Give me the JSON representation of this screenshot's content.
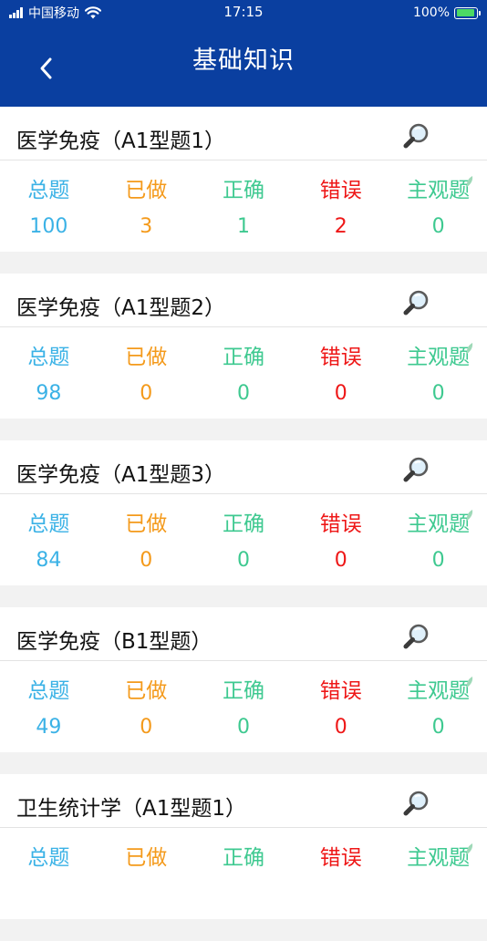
{
  "status": {
    "carrier": "中国移动",
    "time": "17:15",
    "battery": "100%"
  },
  "header": {
    "title": "基础知识"
  },
  "stat_labels": {
    "total": "总题",
    "done": "已做",
    "correct": "正确",
    "wrong": "错误",
    "subjective": "主观题"
  },
  "colors": {
    "header_bg": "#0a3fa0",
    "total": "#3bb2e6",
    "done": "#f49a1b",
    "correct": "#3ec990",
    "wrong": "#ee1717",
    "subjective": "#3ec990"
  },
  "sections": [
    {
      "title": "医学免疫（A1型题1）",
      "total": "100",
      "done": "3",
      "correct": "1",
      "wrong": "2",
      "subjective": "0"
    },
    {
      "title": "医学免疫（A1型题2）",
      "total": "98",
      "done": "0",
      "correct": "0",
      "wrong": "0",
      "subjective": "0"
    },
    {
      "title": "医学免疫（A1型题3）",
      "total": "84",
      "done": "0",
      "correct": "0",
      "wrong": "0",
      "subjective": "0"
    },
    {
      "title": "医学免疫（B1型题）",
      "total": "49",
      "done": "0",
      "correct": "0",
      "wrong": "0",
      "subjective": "0"
    },
    {
      "title": "卫生统计学（A1型题1）"
    }
  ],
  "icons": {
    "back": "chevron-left-icon",
    "search": "magnifier-icon"
  }
}
